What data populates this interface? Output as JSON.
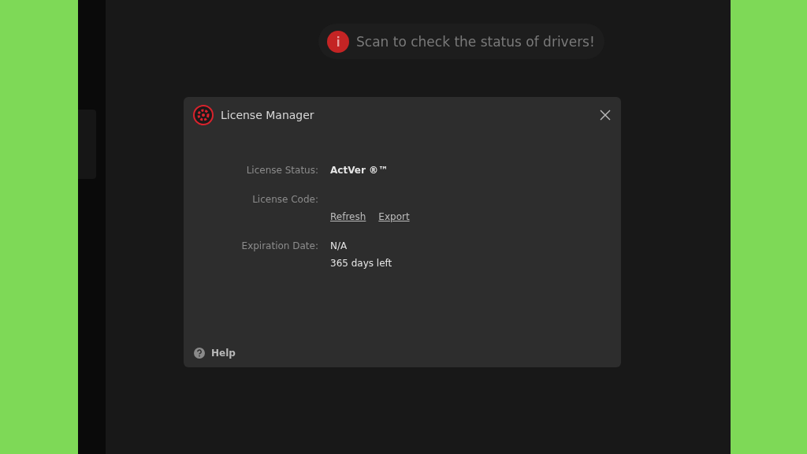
{
  "banner": {
    "text": "Scan to check the status of drivers!"
  },
  "dialog": {
    "title": "License Manager",
    "fields": [
      {
        "kind": "status",
        "label": "License Status:",
        "value": "ActVer ®™"
      },
      {
        "kind": "code",
        "label": "License Code:",
        "links": [
          "Refresh",
          "Export"
        ]
      },
      {
        "kind": "expiry",
        "label": "Expiration Date:",
        "value": "N/A",
        "note": "365 days left"
      }
    ],
    "help": "Help"
  }
}
